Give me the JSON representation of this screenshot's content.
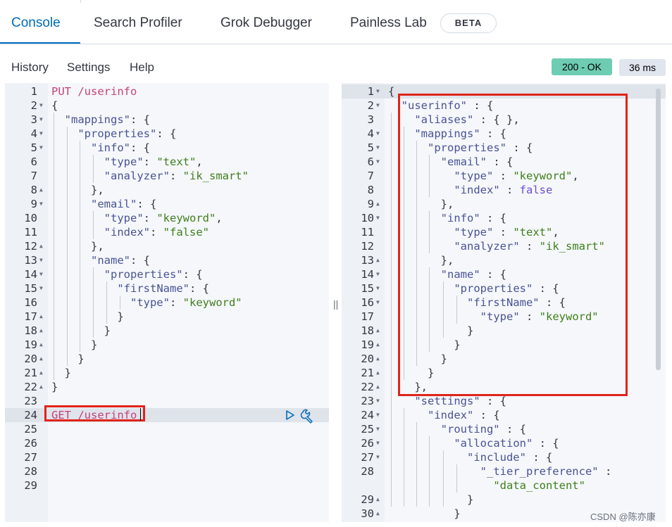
{
  "tabs": [
    {
      "label": "Console",
      "active": true
    },
    {
      "label": "Search Profiler"
    },
    {
      "label": "Grok Debugger"
    },
    {
      "label": "Painless Lab"
    }
  ],
  "beta_badge": "BETA",
  "menu": {
    "history": "History",
    "settings": "Settings",
    "help": "Help"
  },
  "status": {
    "code": "200 - OK",
    "time": "36 ms"
  },
  "colors": {
    "accent": "#006bb8",
    "status_ok": "#6dccb1",
    "highlight_box": "#e0241b"
  },
  "icons": {
    "run": "play-icon",
    "settings": "wrench-icon"
  },
  "request_editor": {
    "lines": [
      {
        "n": "1",
        "fold": "",
        "tokens": [
          [
            "m",
            "PUT /userinfo"
          ]
        ]
      },
      {
        "n": "2",
        "fold": "down",
        "tokens": [
          [
            "p",
            "{"
          ]
        ]
      },
      {
        "n": "3",
        "fold": "down",
        "tokens": [
          [
            "p",
            "  "
          ],
          [
            "k",
            "\"mappings\""
          ],
          [
            "p",
            ": {"
          ]
        ]
      },
      {
        "n": "4",
        "fold": "down",
        "tokens": [
          [
            "p",
            "    "
          ],
          [
            "k",
            "\"properties\""
          ],
          [
            "p",
            ": {"
          ]
        ]
      },
      {
        "n": "5",
        "fold": "down",
        "tokens": [
          [
            "p",
            "      "
          ],
          [
            "k",
            "\"info\""
          ],
          [
            "p",
            ": {"
          ]
        ]
      },
      {
        "n": "6",
        "fold": "",
        "tokens": [
          [
            "p",
            "        "
          ],
          [
            "k",
            "\"type\""
          ],
          [
            "p",
            ": "
          ],
          [
            "s",
            "\"text\""
          ],
          [
            "p",
            ","
          ]
        ]
      },
      {
        "n": "7",
        "fold": "",
        "tokens": [
          [
            "p",
            "        "
          ],
          [
            "k",
            "\"analyzer\""
          ],
          [
            "p",
            ": "
          ],
          [
            "s",
            "\"ik_smart\""
          ]
        ]
      },
      {
        "n": "8",
        "fold": "up",
        "tokens": [
          [
            "p",
            "      },"
          ]
        ]
      },
      {
        "n": "9",
        "fold": "down",
        "tokens": [
          [
            "p",
            "      "
          ],
          [
            "k",
            "\"email\""
          ],
          [
            "p",
            ": {"
          ]
        ]
      },
      {
        "n": "10",
        "fold": "",
        "tokens": [
          [
            "p",
            "        "
          ],
          [
            "k",
            "\"type\""
          ],
          [
            "p",
            ": "
          ],
          [
            "s",
            "\"keyword\""
          ],
          [
            "p",
            ","
          ]
        ]
      },
      {
        "n": "11",
        "fold": "",
        "tokens": [
          [
            "p",
            "        "
          ],
          [
            "k",
            "\"index\""
          ],
          [
            "p",
            ": "
          ],
          [
            "s",
            "\"false\""
          ]
        ]
      },
      {
        "n": "12",
        "fold": "up",
        "tokens": [
          [
            "p",
            "      },"
          ]
        ]
      },
      {
        "n": "13",
        "fold": "down",
        "tokens": [
          [
            "p",
            "      "
          ],
          [
            "k",
            "\"name\""
          ],
          [
            "p",
            ": {"
          ]
        ]
      },
      {
        "n": "14",
        "fold": "down",
        "tokens": [
          [
            "p",
            "        "
          ],
          [
            "k",
            "\"properties\""
          ],
          [
            "p",
            ": {"
          ]
        ]
      },
      {
        "n": "15",
        "fold": "down",
        "tokens": [
          [
            "p",
            "          "
          ],
          [
            "k",
            "\"firstName\""
          ],
          [
            "p",
            ": {"
          ]
        ]
      },
      {
        "n": "16",
        "fold": "",
        "tokens": [
          [
            "p",
            "            "
          ],
          [
            "k",
            "\"type\""
          ],
          [
            "p",
            ": "
          ],
          [
            "s",
            "\"keyword\""
          ]
        ]
      },
      {
        "n": "17",
        "fold": "up",
        "tokens": [
          [
            "p",
            "          }"
          ]
        ]
      },
      {
        "n": "18",
        "fold": "up",
        "tokens": [
          [
            "p",
            "        }"
          ]
        ]
      },
      {
        "n": "19",
        "fold": "up",
        "tokens": [
          [
            "p",
            "      }"
          ]
        ]
      },
      {
        "n": "20",
        "fold": "up",
        "tokens": [
          [
            "p",
            "    }"
          ]
        ]
      },
      {
        "n": "21",
        "fold": "up",
        "tokens": [
          [
            "p",
            "  }"
          ]
        ]
      },
      {
        "n": "22",
        "fold": "up",
        "tokens": [
          [
            "p",
            "}"
          ]
        ]
      },
      {
        "n": "23",
        "fold": "",
        "tokens": []
      },
      {
        "n": "24",
        "fold": "",
        "tokens": [
          [
            "m",
            "GET /userinfo"
          ]
        ],
        "active": true
      },
      {
        "n": "25",
        "fold": "",
        "tokens": []
      },
      {
        "n": "26",
        "fold": "",
        "tokens": []
      },
      {
        "n": "27",
        "fold": "",
        "tokens": []
      },
      {
        "n": "28",
        "fold": "",
        "tokens": []
      },
      {
        "n": "29",
        "fold": "",
        "tokens": []
      }
    ]
  },
  "response_editor": {
    "lines": [
      {
        "n": "1",
        "fold": "down",
        "tokens": [
          [
            "p",
            "{"
          ]
        ],
        "active": true
      },
      {
        "n": "2",
        "fold": "down",
        "tokens": [
          [
            "p",
            "  "
          ],
          [
            "k",
            "\"userinfo\""
          ],
          [
            "p",
            " : {"
          ]
        ]
      },
      {
        "n": "3",
        "fold": "",
        "tokens": [
          [
            "p",
            "    "
          ],
          [
            "k",
            "\"aliases\""
          ],
          [
            "p",
            " : { },"
          ]
        ]
      },
      {
        "n": "4",
        "fold": "down",
        "tokens": [
          [
            "p",
            "    "
          ],
          [
            "k",
            "\"mappings\""
          ],
          [
            "p",
            " : {"
          ]
        ]
      },
      {
        "n": "5",
        "fold": "down",
        "tokens": [
          [
            "p",
            "      "
          ],
          [
            "k",
            "\"properties\""
          ],
          [
            "p",
            " : {"
          ]
        ]
      },
      {
        "n": "6",
        "fold": "down",
        "tokens": [
          [
            "p",
            "        "
          ],
          [
            "k",
            "\"email\""
          ],
          [
            "p",
            " : {"
          ]
        ]
      },
      {
        "n": "7",
        "fold": "",
        "tokens": [
          [
            "p",
            "          "
          ],
          [
            "k",
            "\"type\""
          ],
          [
            "p",
            " : "
          ],
          [
            "s",
            "\"keyword\""
          ],
          [
            "p",
            ","
          ]
        ]
      },
      {
        "n": "8",
        "fold": "",
        "tokens": [
          [
            "p",
            "          "
          ],
          [
            "k",
            "\"index\""
          ],
          [
            "p",
            " : "
          ],
          [
            "b",
            "false"
          ]
        ]
      },
      {
        "n": "9",
        "fold": "up",
        "tokens": [
          [
            "p",
            "        },"
          ]
        ]
      },
      {
        "n": "10",
        "fold": "down",
        "tokens": [
          [
            "p",
            "        "
          ],
          [
            "k",
            "\"info\""
          ],
          [
            "p",
            " : {"
          ]
        ]
      },
      {
        "n": "11",
        "fold": "",
        "tokens": [
          [
            "p",
            "          "
          ],
          [
            "k",
            "\"type\""
          ],
          [
            "p",
            " : "
          ],
          [
            "s",
            "\"text\""
          ],
          [
            "p",
            ","
          ]
        ]
      },
      {
        "n": "12",
        "fold": "",
        "tokens": [
          [
            "p",
            "          "
          ],
          [
            "k",
            "\"analyzer\""
          ],
          [
            "p",
            " : "
          ],
          [
            "s",
            "\"ik_smart\""
          ]
        ]
      },
      {
        "n": "13",
        "fold": "up",
        "tokens": [
          [
            "p",
            "        },"
          ]
        ]
      },
      {
        "n": "14",
        "fold": "down",
        "tokens": [
          [
            "p",
            "        "
          ],
          [
            "k",
            "\"name\""
          ],
          [
            "p",
            " : {"
          ]
        ]
      },
      {
        "n": "15",
        "fold": "down",
        "tokens": [
          [
            "p",
            "          "
          ],
          [
            "k",
            "\"properties\""
          ],
          [
            "p",
            " : {"
          ]
        ]
      },
      {
        "n": "16",
        "fold": "down",
        "tokens": [
          [
            "p",
            "            "
          ],
          [
            "k",
            "\"firstName\""
          ],
          [
            "p",
            " : {"
          ]
        ]
      },
      {
        "n": "17",
        "fold": "",
        "tokens": [
          [
            "p",
            "              "
          ],
          [
            "k",
            "\"type\""
          ],
          [
            "p",
            " : "
          ],
          [
            "s",
            "\"keyword\""
          ]
        ]
      },
      {
        "n": "18",
        "fold": "up",
        "tokens": [
          [
            "p",
            "            }"
          ]
        ]
      },
      {
        "n": "19",
        "fold": "up",
        "tokens": [
          [
            "p",
            "          }"
          ]
        ]
      },
      {
        "n": "20",
        "fold": "up",
        "tokens": [
          [
            "p",
            "        }"
          ]
        ]
      },
      {
        "n": "21",
        "fold": "up",
        "tokens": [
          [
            "p",
            "      }"
          ]
        ]
      },
      {
        "n": "22",
        "fold": "up",
        "tokens": [
          [
            "p",
            "    },"
          ]
        ]
      },
      {
        "n": "23",
        "fold": "down",
        "tokens": [
          [
            "p",
            "    "
          ],
          [
            "k",
            "\"settings\""
          ],
          [
            "p",
            " : {"
          ]
        ]
      },
      {
        "n": "24",
        "fold": "down",
        "tokens": [
          [
            "p",
            "      "
          ],
          [
            "k",
            "\"index\""
          ],
          [
            "p",
            " : {"
          ]
        ]
      },
      {
        "n": "25",
        "fold": "down",
        "tokens": [
          [
            "p",
            "        "
          ],
          [
            "k",
            "\"routing\""
          ],
          [
            "p",
            " : {"
          ]
        ]
      },
      {
        "n": "26",
        "fold": "down",
        "tokens": [
          [
            "p",
            "          "
          ],
          [
            "k",
            "\"allocation\""
          ],
          [
            "p",
            " : {"
          ]
        ]
      },
      {
        "n": "27",
        "fold": "down",
        "tokens": [
          [
            "p",
            "            "
          ],
          [
            "k",
            "\"include\""
          ],
          [
            "p",
            " : {"
          ]
        ]
      },
      {
        "n": "28",
        "fold": "",
        "tokens": [
          [
            "p",
            "              "
          ],
          [
            "k",
            "\"_tier_preference\""
          ],
          [
            "p",
            " :"
          ]
        ]
      },
      {
        "n": "",
        "fold": "",
        "tokens": [
          [
            "p",
            "                "
          ],
          [
            "s",
            "\"data_content\""
          ]
        ]
      },
      {
        "n": "29",
        "fold": "up",
        "tokens": [
          [
            "p",
            "            }"
          ]
        ]
      },
      {
        "n": "30",
        "fold": "up",
        "tokens": [
          [
            "p",
            "          }"
          ]
        ]
      }
    ]
  },
  "watermark": "CSDN @陈亦康"
}
